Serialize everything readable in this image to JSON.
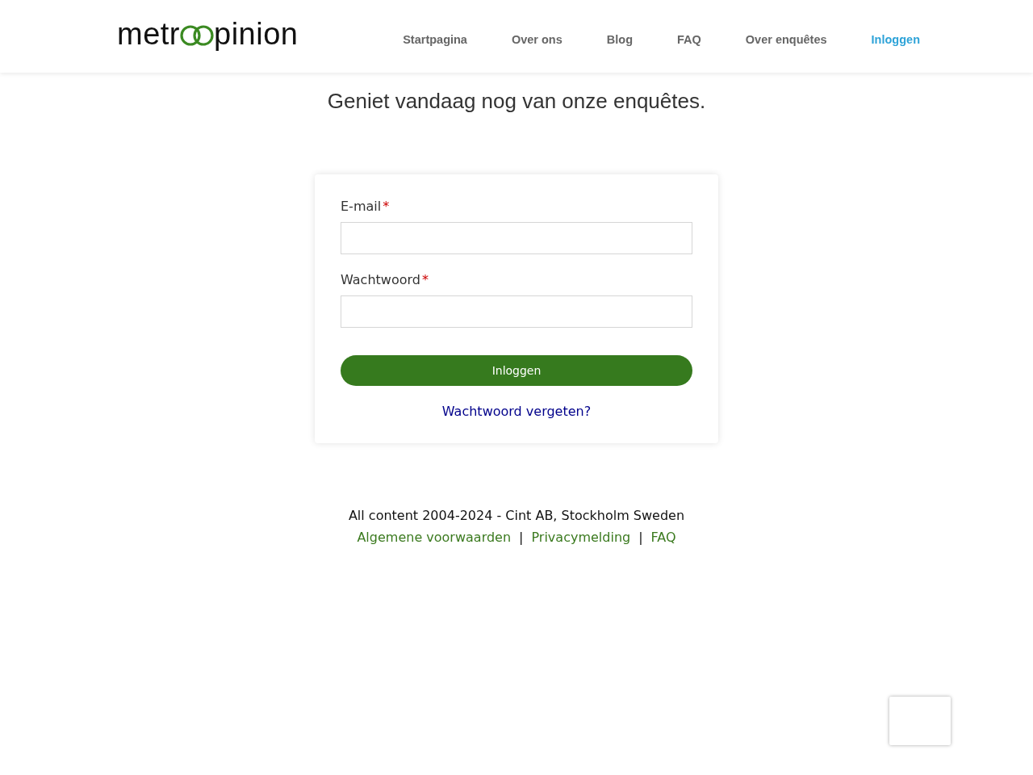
{
  "logo": {
    "before": "metr",
    "after": "pinion"
  },
  "nav": [
    {
      "label": "Startpagina",
      "selected": false
    },
    {
      "label": "Over ons",
      "selected": false
    },
    {
      "label": "Blog",
      "selected": false
    },
    {
      "label": "FAQ",
      "selected": false
    },
    {
      "label": "Over enquêtes",
      "selected": false
    },
    {
      "label": "Inloggen",
      "selected": true
    }
  ],
  "heading": "Geniet vandaag nog van onze enquêtes.",
  "form": {
    "fields": [
      {
        "label": "E-mail",
        "required_mark": "*"
      },
      {
        "label": "Wachtwoord",
        "required_mark": "*"
      }
    ],
    "submit": "Inloggen",
    "forgot_link": "Wachtwoord vergeten?"
  },
  "footer": {
    "copyright": "All content 2004-2024 - Cint AB, Stockholm Sweden",
    "links": [
      "Algemene voorwaarden",
      "Privacymelding",
      "FAQ"
    ],
    "separator": "|"
  }
}
